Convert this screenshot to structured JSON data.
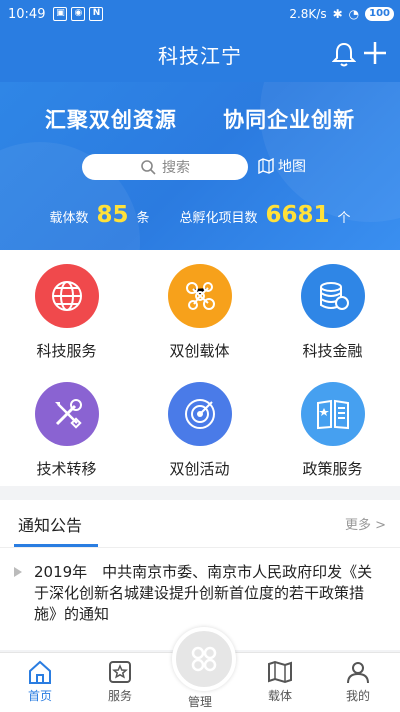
{
  "status": {
    "time": "10:49",
    "network": "2.8K/s",
    "battery": "100"
  },
  "header": {
    "title": "科技江宁"
  },
  "banner": {
    "slogan_left": "汇聚双创资源",
    "slogan_right": "协同企业创新",
    "search_placeholder": "搜索",
    "map_label": "地图",
    "carrier_label": "载体数",
    "carrier_count": "85",
    "carrier_unit": "条",
    "projects_label": "总孵化项目数",
    "projects_count": "6681",
    "projects_unit": "个"
  },
  "services": [
    {
      "label": "科技服务",
      "icon": "globe-icon",
      "color": "#f0494c"
    },
    {
      "label": "双创载体",
      "icon": "network-icon",
      "color": "#f7a11b"
    },
    {
      "label": "科技金融",
      "icon": "coins-icon",
      "color": "#2f86e6"
    },
    {
      "label": "技术转移",
      "icon": "tools-icon",
      "color": "#8a63d2"
    },
    {
      "label": "双创活动",
      "icon": "radar-icon",
      "color": "#4a7be8"
    },
    {
      "label": "政策服务",
      "icon": "book-icon",
      "color": "#46a0f0"
    }
  ],
  "notice": {
    "title": "通知公告",
    "more": "更多 >",
    "item": "2019年　中共南京市委、南京市人民政府印发《关于深化创新名城建设提升创新首位度的若干政策措施》的通知"
  },
  "nav": {
    "home": "首页",
    "service": "服务",
    "manage": "管理",
    "carrier": "载体",
    "mine": "我的"
  }
}
